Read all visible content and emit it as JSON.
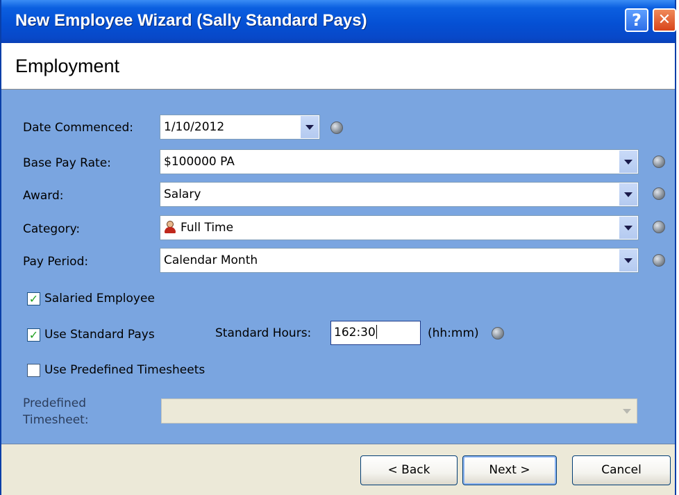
{
  "window": {
    "title": "New Employee Wizard (Sally Standard Pays)",
    "help_glyph": "?",
    "close_glyph": "✕"
  },
  "page": {
    "heading": "Employment"
  },
  "form": {
    "date_commenced": {
      "label": "Date Commenced:",
      "value": "1/10/2012"
    },
    "base_pay_rate": {
      "label": "Base Pay Rate:",
      "value": "$100000 PA"
    },
    "award": {
      "label": "Award:",
      "value": "Salary"
    },
    "category": {
      "label": "Category:",
      "value": "Full Time",
      "icon": "person-icon"
    },
    "pay_period": {
      "label": "Pay Period:",
      "value": "Calendar Month"
    },
    "salaried_employee": {
      "label": "Salaried Employee",
      "checked": true
    },
    "use_standard_pays": {
      "label": "Use Standard Pays",
      "checked": true
    },
    "standard_hours": {
      "label": "Standard Hours:",
      "value": "162:30",
      "unit": "(hh:mm)"
    },
    "use_predefined_timesheets": {
      "label": "Use Predefined Timesheets",
      "checked": false
    },
    "predefined_timesheet": {
      "label_line1": "Predefined",
      "label_line2": "Timesheet:",
      "value": ""
    }
  },
  "buttons": {
    "back": "< Back",
    "next": "Next >",
    "cancel": "Cancel"
  },
  "colors": {
    "title_bar": "#0550d4",
    "content_bg": "#7aa5e0",
    "footer_bg": "#ece9d8",
    "check": "#21a121"
  }
}
